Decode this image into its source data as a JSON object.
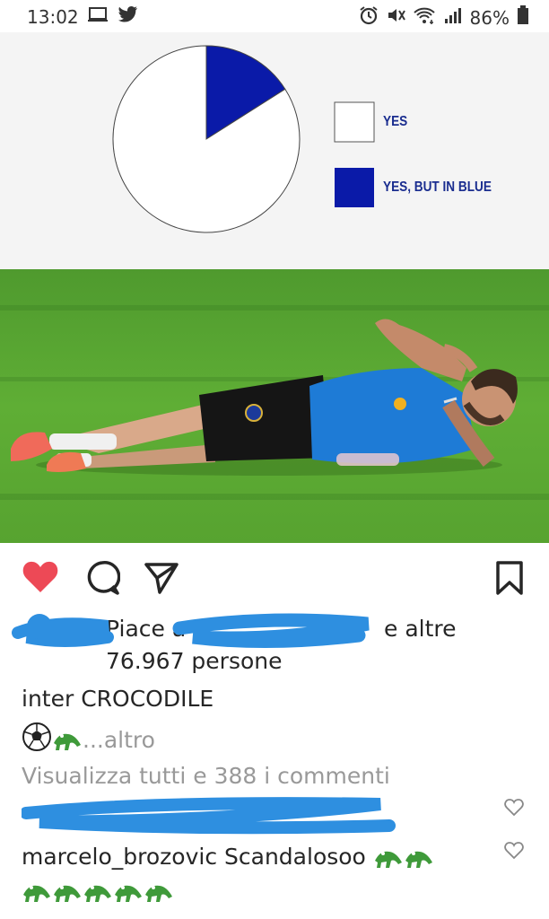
{
  "status_bar": {
    "time": "13:02",
    "battery": "86%"
  },
  "chart_data": {
    "type": "pie",
    "title": "",
    "slices": [
      {
        "label": "YES",
        "value": 84,
        "color": "#ffffff"
      },
      {
        "label": "YES, BUT IN BLUE",
        "value": 16,
        "color": "#0a1aa8"
      }
    ],
    "legend_placement": "right"
  },
  "post": {
    "likes_prefix": "Piace a",
    "likes_suffix": "e altre",
    "likes_count_line": "76.967 persone",
    "caption_user": "inter",
    "caption_text": "CROCODILE",
    "caption_more": "...altro",
    "view_all_comments": "Visualizza tutti e 388 i commenti",
    "comments": [
      {
        "user": "marcelo_brozovic",
        "text": "Scandalosoo"
      }
    ]
  },
  "colors": {
    "like_red": "#ed4956",
    "chart_blue": "#0a1aa8",
    "scribble_blue": "#2e8fe0"
  }
}
